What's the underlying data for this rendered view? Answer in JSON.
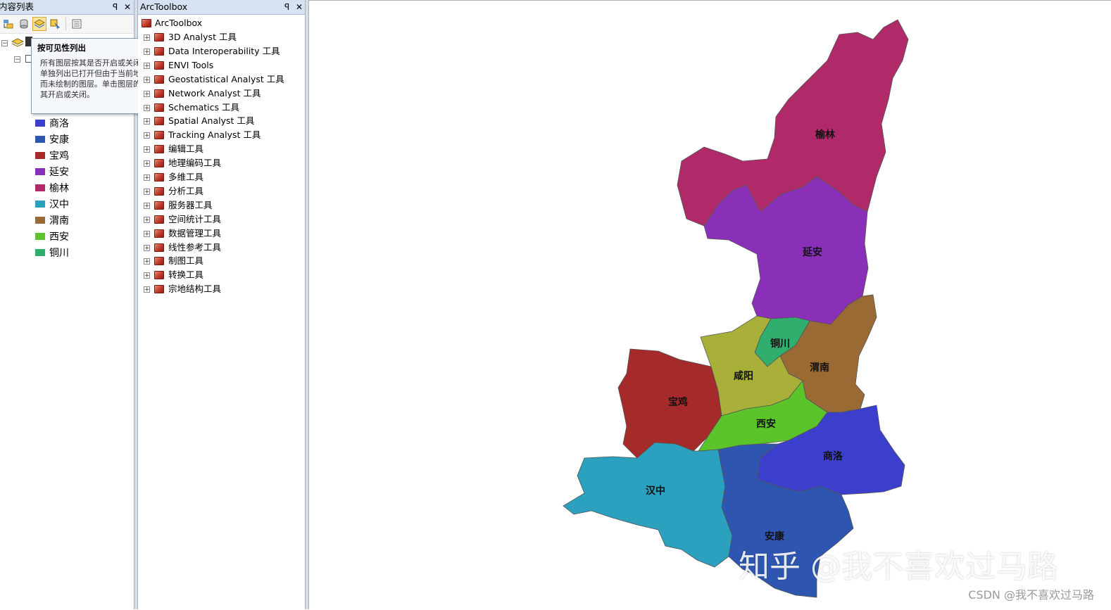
{
  "toc": {
    "title": "内容列表",
    "pin": "ꟼ",
    "close": "✕",
    "toolbar": [
      "list-by-drawing-order",
      "list-by-source",
      "list-by-visibility",
      "list-by-selection",
      "options"
    ],
    "legend": [
      {
        "label": "商洛",
        "color": "#3b3fcb"
      },
      {
        "label": "安康",
        "color": "#2e56b0"
      },
      {
        "label": "宝鸡",
        "color": "#a52a2a"
      },
      {
        "label": "延安",
        "color": "#8a2fb8"
      },
      {
        "label": "榆林",
        "color": "#b02a6a"
      },
      {
        "label": "汉中",
        "color": "#2ba0bf"
      },
      {
        "label": "渭南",
        "color": "#9a6a35"
      },
      {
        "label": "西安",
        "color": "#5bc42a"
      },
      {
        "label": "铜川",
        "color": "#2fae6e"
      }
    ]
  },
  "tooltip": {
    "title": "按可见性列出",
    "body": "所有图层按其是否开启或关闭列出。单独列出已打开但由于当前地图比例而未绘制的图层。单击图层的图标将其开启或关闭。"
  },
  "toolbox": {
    "title": "ArcToolbox",
    "pin": "ꟼ",
    "close": "✕",
    "root": "ArcToolbox",
    "items": [
      "3D Analyst 工具",
      "Data Interoperability 工具",
      "ENVI Tools",
      "Geostatistical Analyst 工具",
      "Network Analyst 工具",
      "Schematics 工具",
      "Spatial Analyst 工具",
      "Tracking Analyst 工具",
      "编辑工具",
      "地理编码工具",
      "多维工具",
      "分析工具",
      "服务器工具",
      "空间统计工具",
      "数据管理工具",
      "线性参考工具",
      "制图工具",
      "转换工具",
      "宗地结构工具"
    ]
  },
  "map": {
    "regions": {
      "yulin": {
        "label": "榆林",
        "color": "#b02a6a"
      },
      "yanan": {
        "label": "延安",
        "color": "#8a2fb8"
      },
      "tongchuan": {
        "label": "铜川",
        "color": "#2fae6e"
      },
      "weinan": {
        "label": "渭南",
        "color": "#9a6a35"
      },
      "xianyang": {
        "label": "咸阳",
        "color": "#a8b03a"
      },
      "baoji": {
        "label": "宝鸡",
        "color": "#a52a2a"
      },
      "xian": {
        "label": "西安",
        "color": "#5bc42a"
      },
      "shangluo": {
        "label": "商洛",
        "color": "#3b3fcb"
      },
      "hanzhong": {
        "label": "汉中",
        "color": "#2ba0bf"
      },
      "ankang": {
        "label": "安康",
        "color": "#2e56b0"
      }
    },
    "watermark": "知乎 @我不喜欢过马路",
    "credit": "CSDN @我不喜欢过马路"
  }
}
